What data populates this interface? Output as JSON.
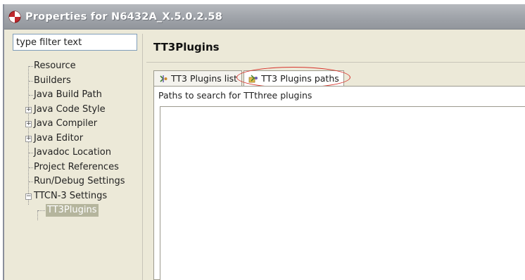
{
  "window": {
    "title": "Properties for N6432A_X.5.0.2.58"
  },
  "filter": {
    "placeholder": "type filter text",
    "value": "type filter text"
  },
  "tree": {
    "items": [
      {
        "label": "Resource",
        "expandable": false
      },
      {
        "label": "Builders",
        "expandable": false
      },
      {
        "label": "Java Build Path",
        "expandable": false
      },
      {
        "label": "Java Code Style",
        "expandable": true,
        "expanded": false
      },
      {
        "label": "Java Compiler",
        "expandable": true,
        "expanded": false
      },
      {
        "label": "Java Editor",
        "expandable": true,
        "expanded": false
      },
      {
        "label": "Javadoc Location",
        "expandable": false
      },
      {
        "label": "Project References",
        "expandable": false
      },
      {
        "label": "Run/Debug Settings",
        "expandable": false
      },
      {
        "label": "TTCN-3 Settings",
        "expandable": true,
        "expanded": true
      },
      {
        "label": "TT3Plugins",
        "child": true,
        "selected": true
      }
    ]
  },
  "main": {
    "title": "TT3Plugins",
    "tabs": [
      {
        "label": "TT3 Plugins list",
        "active": false,
        "icon": "plugin-icon"
      },
      {
        "label": "TT3 Plugins paths",
        "active": true,
        "icon": "plugin-folder-icon"
      }
    ],
    "panel_label": "Paths to search for TTthree plugins"
  },
  "colors": {
    "titlebar": "#9fa3a9",
    "selection": "#b5b59d",
    "highlight": "#d8342c"
  }
}
